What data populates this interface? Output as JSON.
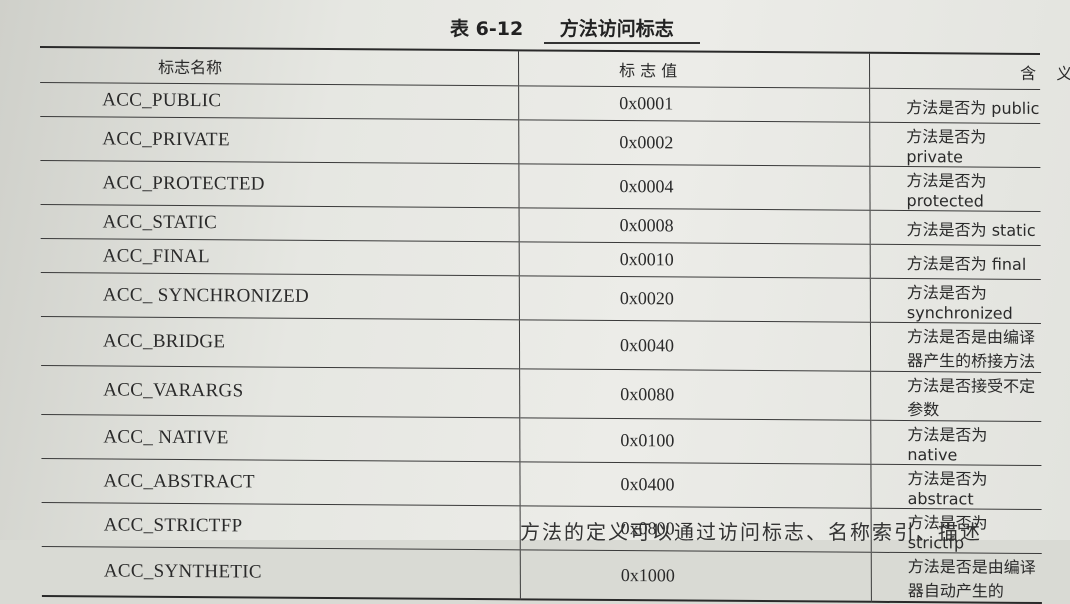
{
  "caption": {
    "number": "表 6-12",
    "title": "方法访问标志"
  },
  "headers": {
    "name": "标志名称",
    "value": "标 志 值",
    "meaning": "含    义"
  },
  "rows": [
    {
      "name": "ACC_PUBLIC",
      "value": "0x0001",
      "meaning": "方法是否为 public"
    },
    {
      "name": "ACC_PRIVATE",
      "value": "0x0002",
      "meaning": "方法是否为 private"
    },
    {
      "name": "ACC_PROTECTED",
      "value": "0x0004",
      "meaning": "方法是否为 protected"
    },
    {
      "name": "ACC_STATIC",
      "value": "0x0008",
      "meaning": "方法是否为 static"
    },
    {
      "name": "ACC_FINAL",
      "value": "0x0010",
      "meaning": "方法是否为 final"
    },
    {
      "name": "ACC_ SYNCHRONIZED",
      "value": "0x0020",
      "meaning": "方法是否为 synchronized"
    },
    {
      "name": "ACC_BRIDGE",
      "value": "0x0040",
      "meaning": "方法是否是由编译器产生的桥接方法"
    },
    {
      "name": "ACC_VARARGS",
      "value": "0x0080",
      "meaning": "方法是否接受不定参数"
    },
    {
      "name": "ACC_ NATIVE",
      "value": "0x0100",
      "meaning": "方法是否为 native"
    },
    {
      "name": "ACC_ABSTRACT",
      "value": "0x0400",
      "meaning": "方法是否为 abstract"
    },
    {
      "name": "ACC_STRICTFP",
      "value": "0x0800",
      "meaning": "方法是否为 strictfp"
    },
    {
      "name": "ACC_SYNTHETIC",
      "value": "0x1000",
      "meaning": "方法是否是由编译器自动产生的"
    }
  ],
  "bottom_text": "方法的定义可以通过访问标志、名称索引、描述"
}
